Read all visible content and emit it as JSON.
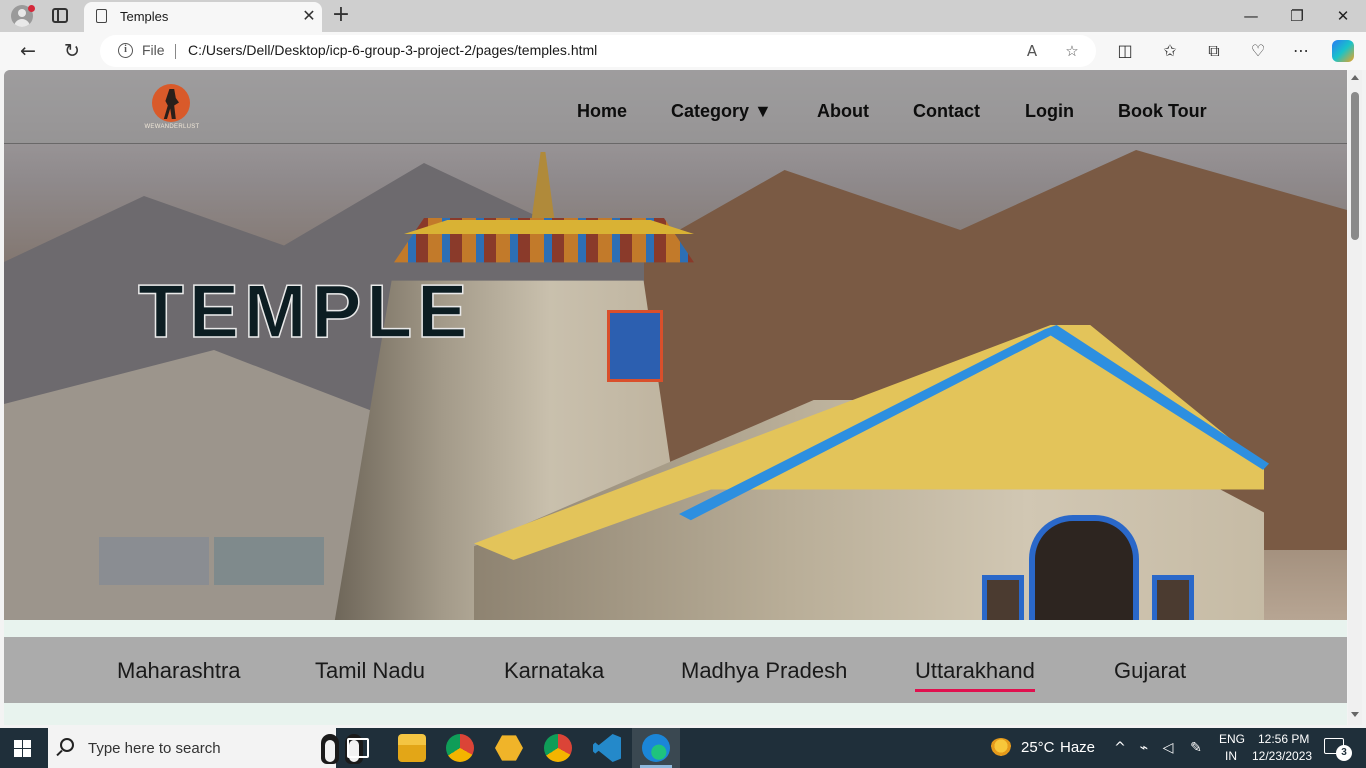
{
  "browser": {
    "tab_title": "Temples",
    "new_tab": "+",
    "tab_close": "✕",
    "address": {
      "scheme_label": "File",
      "url": "C:/Users/Dell/Desktop/icp-6-group-3-project-2/pages/temples.html"
    },
    "nav": {
      "back": "←",
      "reload": "↻"
    },
    "window_controls": {
      "minimize": "—",
      "maximize": "❐",
      "close": "✕"
    },
    "toolbar_icons": [
      "read-aloud-icon",
      "favorite-star-icon",
      "split-screen-icon",
      "favorites-icon",
      "collections-icon",
      "browser-essentials-icon",
      "more-icon",
      "copilot-icon"
    ]
  },
  "site": {
    "logo_text": "WEWANDERLUST",
    "nav_links": [
      "Home",
      "Category ▼",
      "About",
      "Contact",
      "Login",
      "Book Tour"
    ],
    "hero_title": "TEMPLE",
    "categories": [
      "Maharashtra",
      "Tamil Nadu",
      "Karnataka",
      "Madhya Pradesh",
      "Uttarakhand",
      "Gujarat"
    ],
    "active_category": "Uttarakhand",
    "accent_color": "#e0104e"
  },
  "taskbar": {
    "search_placeholder": "Type here to search",
    "weather": {
      "temp": "25°C",
      "condition": "Haze"
    },
    "language": {
      "lang": "ENG",
      "region": "IN"
    },
    "clock": {
      "time": "12:56 PM",
      "date": "12/23/2023"
    },
    "notification_count": "3"
  }
}
